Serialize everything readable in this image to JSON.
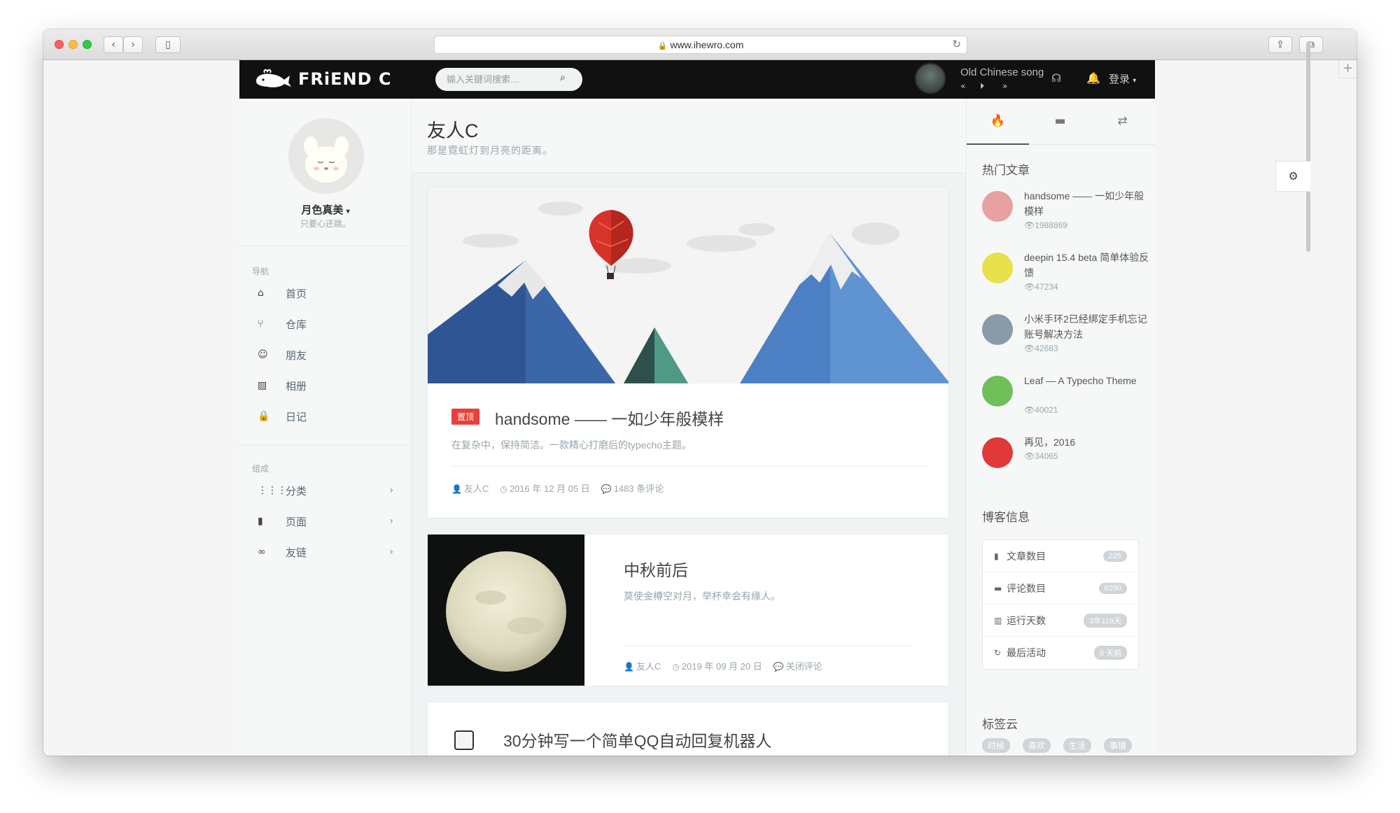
{
  "browser": {
    "url": "www.ihewro.com",
    "back_icon": "chevron-left",
    "forward_icon": "chevron-right",
    "sidebar_icon": "sidebar-toggle",
    "share_icon": "share",
    "tabs_icon": "tabs-overview",
    "new_tab": "+"
  },
  "header": {
    "logo_text": "FRiEND C",
    "search_placeholder": "输入关键词搜索…",
    "music": {
      "title": "Old Chinese song",
      "prev": "«",
      "play": "⏵",
      "next": "»"
    },
    "login": "登录",
    "icons": [
      "headphones-icon",
      "bell-icon"
    ]
  },
  "profile": {
    "name": "月色真美",
    "motto": "只要心还跳。"
  },
  "nav": {
    "heading": "导航",
    "items": [
      {
        "label": "首页",
        "icon": "⌂"
      },
      {
        "label": "仓库",
        "icon": "⑂"
      },
      {
        "label": "朋友",
        "icon": "☺"
      },
      {
        "label": "相册",
        "icon": "▨"
      },
      {
        "label": "日记",
        "icon": "🔒"
      }
    ]
  },
  "compose": {
    "heading": "组成",
    "items": [
      {
        "label": "分类",
        "icon": "⋮⋮⋮"
      },
      {
        "label": "页面",
        "icon": "▮"
      },
      {
        "label": "友链",
        "icon": "∞"
      }
    ]
  },
  "main": {
    "title": "友人C",
    "subtitle": "那是霓虹灯到月亮的距离。"
  },
  "posts": [
    {
      "badge": "置顶",
      "title": "handsome —— 一如少年般模样",
      "excerpt": "在复杂中，保持简洁。一款精心打磨后的typecho主题。",
      "author": "友人C",
      "date": "2016 年 12 月 05 日",
      "comments": "1483 条评论"
    },
    {
      "title": "中秋前后",
      "excerpt": "莫使金樽空对月，举杯幸会有缘人。",
      "author": "友人C",
      "date": "2019 年 09 月 20 日",
      "comments": "关闭评论"
    },
    {
      "title": "30分钟写一个简单QQ自动回复机器人"
    }
  ],
  "right": {
    "hot_heading": "热门文章",
    "hot": [
      {
        "title": "handsome —— 一如少年般模样",
        "views": "1988869",
        "color": "#e8a0a0"
      },
      {
        "title": "deepin 15.4 beta 简单体验反馈",
        "views": "47234",
        "color": "#e8e04a"
      },
      {
        "title": "小米手环2已经绑定手机忘记账号解决方法",
        "views": "42683",
        "color": "#8a9aa8"
      },
      {
        "title": "Leaf — A Typecho Theme",
        "views": "40021",
        "color": "#6fbf5a"
      },
      {
        "title": "再见，2016",
        "views": "34065",
        "color": "#e0393a"
      }
    ],
    "info_heading": "博客信息",
    "info": [
      {
        "label": "文章数目",
        "value": "225",
        "icon": "▮"
      },
      {
        "label": "评论数目",
        "value": "6290",
        "icon": "▬"
      },
      {
        "label": "运行天数",
        "value": "3年118天",
        "icon": "▥"
      },
      {
        "label": "最后活动",
        "value": "6 天前",
        "icon": "↻"
      }
    ],
    "tag_heading": "标签云",
    "tags": [
      "时候",
      "喜欢",
      "生活",
      "事情"
    ]
  }
}
